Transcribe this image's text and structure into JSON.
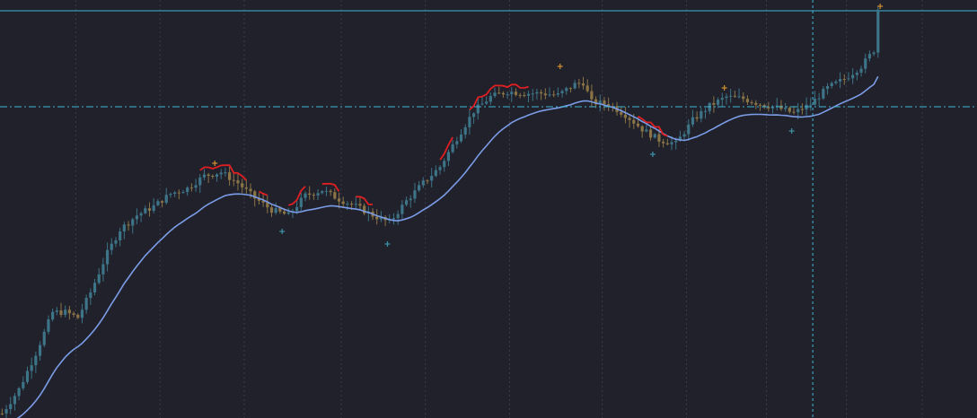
{
  "colors": {
    "background": "#20212b",
    "grid": "#3a3b48",
    "candle_up": "#3d7487",
    "candle_down": "#8a7446",
    "trailing_line_up": "#7b9ce6",
    "trailing_line_down": "#e01f23",
    "marker_high": "#c98a2f",
    "marker_low": "#3a8ea0",
    "crosshair": "#3fb8d6"
  },
  "chart_data": {
    "type": "candlestick",
    "title": "",
    "xlabel": "",
    "ylabel": "",
    "grid": true,
    "legend": "none",
    "ylim": [
      0,
      466
    ],
    "x_range": [
      0,
      232
    ],
    "crosshair": {
      "x": 193,
      "y": 347
    },
    "top_reference_level": 454,
    "anchors": [
      [
        0,
        5
      ],
      [
        4,
        32
      ],
      [
        8,
        72
      ],
      [
        12,
        118
      ],
      [
        15,
        118
      ],
      [
        18,
        112
      ],
      [
        21,
        140
      ],
      [
        25,
        184
      ],
      [
        28,
        210
      ],
      [
        32,
        226
      ],
      [
        36,
        236
      ],
      [
        40,
        250
      ],
      [
        44,
        256
      ],
      [
        48,
        270
      ],
      [
        52,
        274
      ],
      [
        56,
        262
      ],
      [
        60,
        245
      ],
      [
        64,
        232
      ],
      [
        68,
        226
      ],
      [
        72,
        248
      ],
      [
        76,
        254
      ],
      [
        80,
        244
      ],
      [
        84,
        236
      ],
      [
        88,
        226
      ],
      [
        92,
        218
      ],
      [
        96,
        242
      ],
      [
        100,
        262
      ],
      [
        104,
        280
      ],
      [
        108,
        312
      ],
      [
        112,
        342
      ],
      [
        116,
        358
      ],
      [
        120,
        364
      ],
      [
        124,
        362
      ],
      [
        128,
        362
      ],
      [
        132,
        360
      ],
      [
        136,
        372
      ],
      [
        138,
        374
      ],
      [
        140,
        352
      ],
      [
        144,
        350
      ],
      [
        148,
        338
      ],
      [
        152,
        322
      ],
      [
        156,
        310
      ],
      [
        160,
        306
      ],
      [
        164,
        332
      ],
      [
        168,
        348
      ],
      [
        172,
        358
      ],
      [
        176,
        356
      ],
      [
        180,
        350
      ],
      [
        184,
        346
      ],
      [
        188,
        340
      ],
      [
        192,
        350
      ],
      [
        196,
        368
      ],
      [
        200,
        378
      ],
      [
        204,
        392
      ],
      [
        207,
        410
      ],
      [
        208,
        456
      ]
    ],
    "markers": [
      {
        "type": "high",
        "x": 51,
        "value": 284
      },
      {
        "type": "low",
        "x": 67,
        "value": 208
      },
      {
        "type": "low",
        "x": 92,
        "value": 194
      },
      {
        "type": "high",
        "x": 133,
        "value": 392
      },
      {
        "type": "low",
        "x": 155,
        "value": 294
      },
      {
        "type": "high",
        "x": 172,
        "value": 368
      },
      {
        "type": "low",
        "x": 188,
        "value": 320
      },
      {
        "type": "high",
        "x": 209,
        "value": 459
      }
    ]
  }
}
